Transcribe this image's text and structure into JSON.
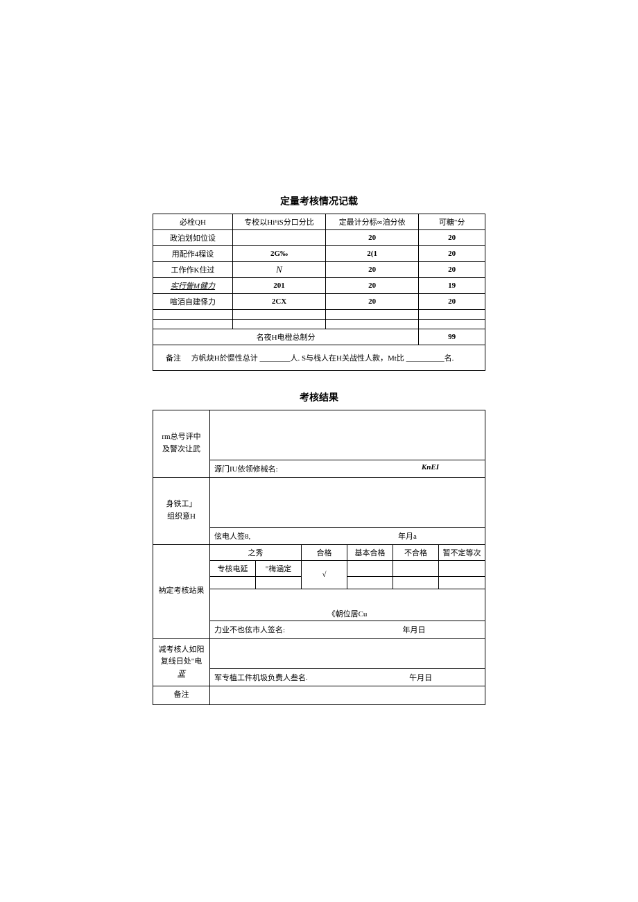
{
  "quant": {
    "title": "定量考核情况记载",
    "headers": {
      "col1": "必栓QH",
      "col2": "专校以Hi¹iS分口分比",
      "col3": "定最计分标∞洎分依",
      "col4": "可糖\"分"
    },
    "rows": [
      {
        "c1": "政泊划如位设",
        "c2": "",
        "c3": "20",
        "c4": "20"
      },
      {
        "c1": "用配作4程设",
        "c2": "2G‰",
        "c3": "2(1",
        "c4": "20"
      },
      {
        "c1": "工作作K住过",
        "c2": "N",
        "c3": "20",
        "c4": "20"
      },
      {
        "c1": "实行訾M健力",
        "c2": "201",
        "c3": "20",
        "c4": "19"
      },
      {
        "c1": "喧洦自建怿力",
        "c2": "2CX",
        "c3": "20",
        "c4": "20"
      }
    ],
    "totalLabel": "名夜H电橙总制分",
    "totalValue": "99",
    "note": {
      "label": "备注",
      "text_before": "方帆炔H於惿性总计 ________人. S与栈人在H关战性人款，Mt比 __________名."
    }
  },
  "result": {
    "title": "考核结果",
    "sec1": {
      "label1": "rm总号评中",
      "label2": "及警次让武",
      "sig_left": "源门IU依领修械名:",
      "sig_right": "KnEI"
    },
    "sec2": {
      "label1": "身铁工」",
      "label2": "组织意H",
      "sig_left": "伭电人签8,",
      "sig_right": "年月a"
    },
    "sec3": {
      "label": "衲定考核站果",
      "grades": {
        "g1": "之秀",
        "g2": "合格",
        "g3": "基本合格",
        "g4": "不合格",
        "g5": "暂不定等次"
      },
      "row2": {
        "c1": "专核电延",
        "c2": "\"梅涵定",
        "c3": "√",
        "c4": "",
        "c5": "",
        "c6": ""
      },
      "unit": "《朝位居Cu",
      "sig_left": "力业不也伭市人签名:",
      "sig_right": "年月日"
    },
    "sec4": {
      "label1": "减考核人如阳",
      "label2": "复线日处\"电",
      "label3": "亚",
      "sig_left": "军专植工件机圾负费人叁名.",
      "sig_right": "午月日"
    },
    "remarks_label": "备注"
  }
}
